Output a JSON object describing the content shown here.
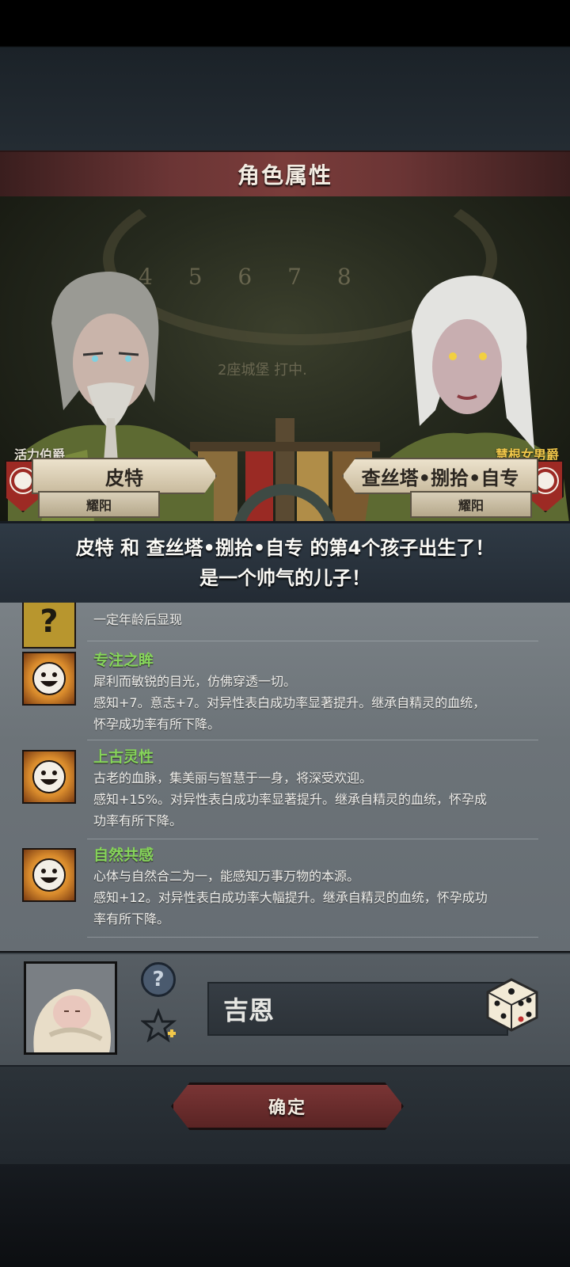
{
  "header": {
    "title": "角色属性"
  },
  "scene": {
    "clock_numbers": "4 5 6 7 8",
    "background_caption": "2座城堡  打中."
  },
  "parents": {
    "left": {
      "title": "活力伯爵",
      "name": "皮特",
      "house": "耀阳"
    },
    "right": {
      "title": "慧根女男爵",
      "name": "查丝塔•捌拾•自专",
      "house": "耀阳"
    }
  },
  "announcement": {
    "line1": "皮特 和 查丝塔•捌拾•自专 的第4个孩子出生了！",
    "line2": "是一个帅气的儿子！"
  },
  "traits": [
    {
      "icon": "question-mark-icon",
      "name": "",
      "desc": "一定年龄后显现"
    },
    {
      "icon": "smiley-sun-icon",
      "name": "专注之眸",
      "desc": "犀利而敏锐的目光，仿佛穿透一切。\n感知+7。意志+7。对异性表白成功率显著提升。继承自精灵的血统，\n怀孕成功率有所下降。"
    },
    {
      "icon": "smiley-sun-icon",
      "name": "上古灵性",
      "desc": "古老的血脉，集美丽与智慧于一身，将深受欢迎。\n感知+15%。对异性表白成功率显著提升。继承自精灵的血统，怀孕成\n功率有所下降。"
    },
    {
      "icon": "smiley-sun-icon",
      "name": "自然共感",
      "desc": "心体与自然合二为一，能感知万事万物的本源。\n感知+12。对异性表白成功率大幅提升。继承自精灵的血统，怀孕成功\n率有所下降。"
    }
  ],
  "child": {
    "name_value": "吉恩",
    "help_label": "?"
  },
  "confirm_label": "确定",
  "colors": {
    "title_bar": "#7a3c3a",
    "trait_name": "#86d45a",
    "right_title": "#f2c84a",
    "crest": "#9d2a24"
  }
}
